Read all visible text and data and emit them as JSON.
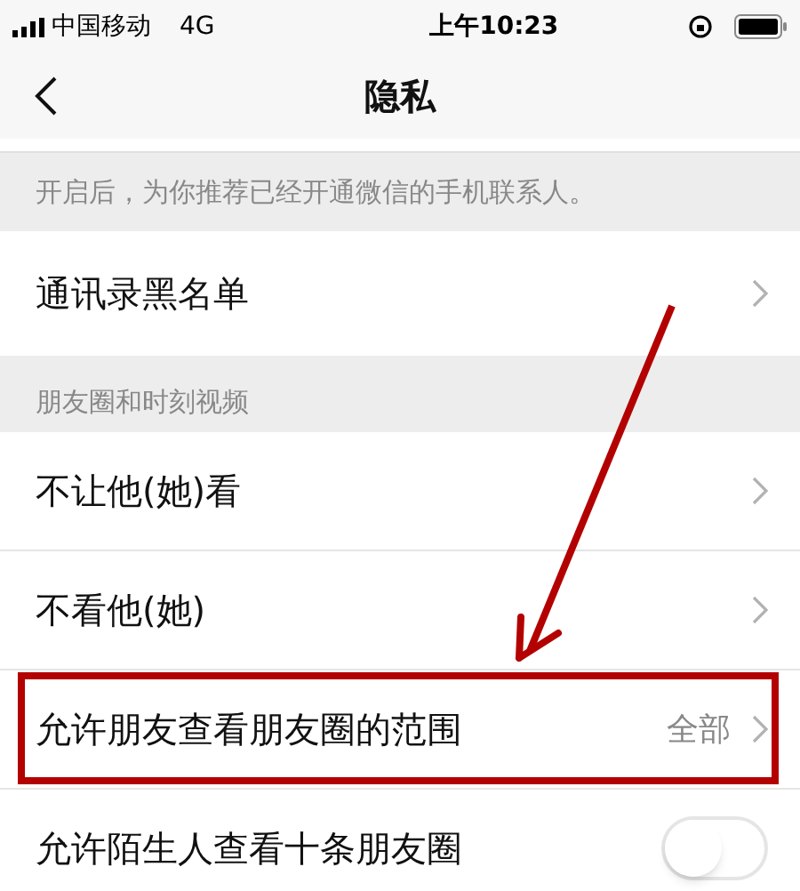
{
  "status_bar": {
    "carrier": "中国移动",
    "network": "4G",
    "time": "上午10:23"
  },
  "nav": {
    "title": "隐私"
  },
  "note": "开启后，为你推荐已经开通微信的手机联系人。",
  "blacklist": {
    "label": "通讯录黑名单"
  },
  "section": {
    "title": "朋友圈和时刻视频",
    "rows": [
      {
        "kind": "link",
        "label": "不让他(她)看",
        "highlighted": false
      },
      {
        "kind": "link",
        "label": "不看他(她)",
        "highlighted": false
      },
      {
        "kind": "link",
        "label": "允许朋友查看朋友圈的范围",
        "value": "全部",
        "highlighted": true
      },
      {
        "kind": "toggle",
        "label": "允许陌生人查看十条朋友圈",
        "on": false,
        "highlighted": false
      }
    ]
  }
}
